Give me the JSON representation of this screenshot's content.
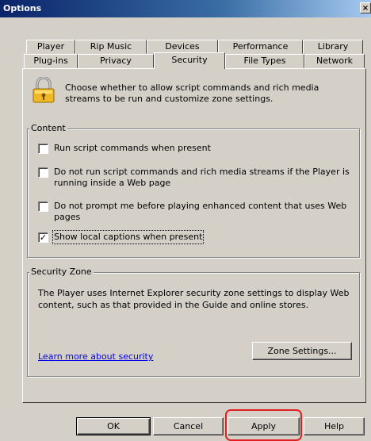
{
  "window": {
    "title": "Options",
    "close_glyph": "×"
  },
  "tabs": {
    "row1": [
      "Player",
      "Rip Music",
      "Devices",
      "Performance",
      "Library"
    ],
    "row2": [
      "Plug-ins",
      "Privacy",
      "Security",
      "File Types",
      "Network"
    ],
    "active": "Security"
  },
  "intro": {
    "icon": "lock-icon",
    "text": "Choose whether to allow script commands and rich media streams to be run and customize zone settings."
  },
  "content_group": {
    "label": "Content",
    "options": [
      {
        "label": "Run script commands when present",
        "checked": false
      },
      {
        "label": "Do not run script commands and rich media streams if the Player is running inside a Web page",
        "checked": false
      },
      {
        "label": "Do not prompt me before playing enhanced content that uses Web pages",
        "checked": false
      },
      {
        "label": "Show local captions when present",
        "checked": true
      }
    ]
  },
  "zone_group": {
    "label": "Security Zone",
    "description": "The Player uses Internet Explorer security zone settings to display Web content, such as that provided in the Guide and online stores.",
    "link": "Learn more about security",
    "button": "Zone Settings..."
  },
  "buttons": {
    "ok": "OK",
    "cancel": "Cancel",
    "apply": "Apply",
    "help": "Help"
  },
  "colors": {
    "dialog_face": "#d4d0c8",
    "title_bar": "#0a246a",
    "link": "#0000ee",
    "highlight": "#e32020"
  }
}
